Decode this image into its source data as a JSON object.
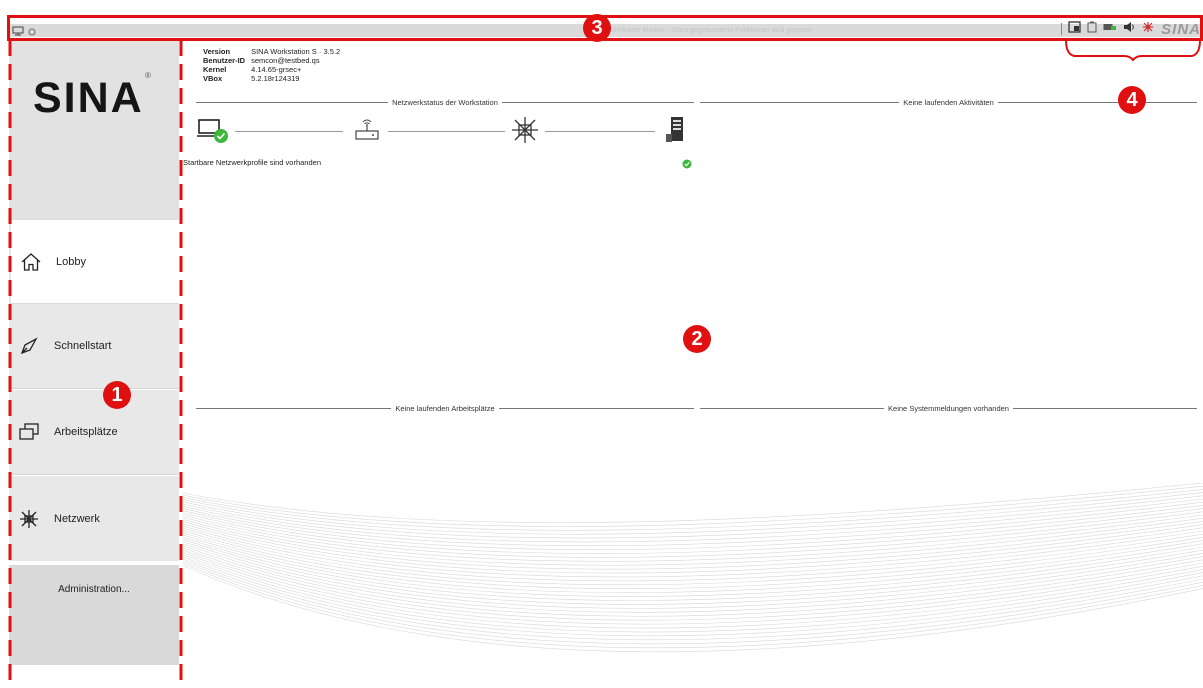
{
  "topbar": {
    "center_text": "Eingeschränkter Modus – Sitzungsgebundene Funktionen sind gesperrt",
    "tray_brand": "SINA"
  },
  "sidebar": {
    "logo": "SINA",
    "logo_mark": "®",
    "items": [
      {
        "label": "Lobby",
        "icon": "home-icon"
      },
      {
        "label": "Schnellstart",
        "icon": "rocket-icon"
      },
      {
        "label": "Arbeitsplätze",
        "icon": "windows-icon"
      },
      {
        "label": "Netzwerk",
        "icon": "network-icon"
      }
    ],
    "admin_label": "Administration..."
  },
  "info": {
    "version_key": "Version",
    "version_val": "SINA Workstation S · 3.5.2",
    "user_key": "Benutzer-ID",
    "user_val": "semcon@testbed.qs",
    "kernel_key": "Kernel",
    "kernel_val": "4.14.65-grsec+",
    "vbox_key": "VBox",
    "vbox_val": "5.2.18r124319"
  },
  "sections": {
    "network": "Netzwerkstatus der Workstation",
    "activities": "Keine laufenden Aktivitäten",
    "workplaces": "Keine laufenden Arbeitsplätze",
    "messages": "Keine Systemmeldungen vorhanden"
  },
  "network_status_text": "Startbare Netzwerkprofile sind vorhanden",
  "annotations": [
    "1",
    "2",
    "3",
    "4"
  ],
  "colors": {
    "annotation_red": "#e01010",
    "ok_green": "#3cb83c",
    "sidebar_gray": "#e8e8e8"
  }
}
